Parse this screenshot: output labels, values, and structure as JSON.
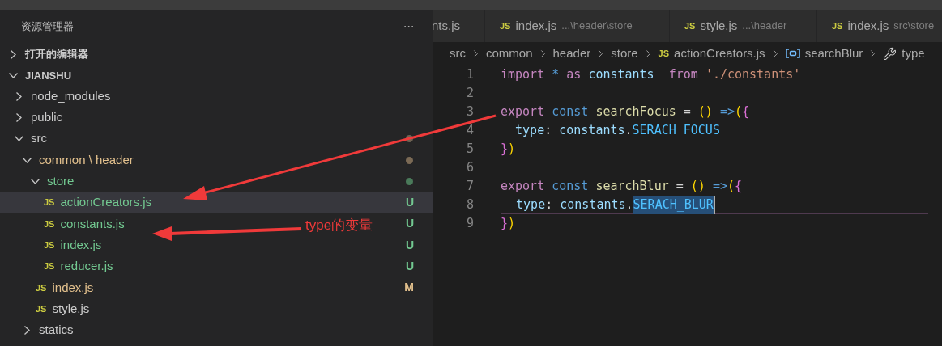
{
  "sidebar": {
    "title": "资源管理器",
    "more": "···",
    "sections": [
      {
        "label": "打开的编辑器",
        "expanded": false
      },
      {
        "label": "JIANSHU",
        "expanded": true
      }
    ],
    "tree": [
      {
        "label": "node_modules",
        "kind": "folder",
        "expanded": false,
        "modified": false,
        "untracked": false
      },
      {
        "label": "public",
        "kind": "folder",
        "expanded": false,
        "modified": false,
        "untracked": false
      },
      {
        "label": "src",
        "kind": "folder",
        "expanded": true,
        "modified": false,
        "untracked": false,
        "color": "#6e6353",
        "children": [
          {
            "label": "common \\ header",
            "kind": "folder",
            "expanded": true,
            "modified": true,
            "untracked": false,
            "color": "#7b6a55",
            "children": [
              {
                "label": "store",
                "kind": "folder",
                "expanded": true,
                "modified": false,
                "untracked": true,
                "color": "#4a7a5a",
                "children": [
                  {
                    "label": "actionCreators.js",
                    "kind": "js",
                    "icon": "JS",
                    "modified": false,
                    "untracked": true,
                    "badge": "U",
                    "selected": true
                  },
                  {
                    "label": "constants.js",
                    "kind": "js",
                    "icon": "JS",
                    "modified": false,
                    "untracked": true,
                    "badge": "U",
                    "selected": false
                  },
                  {
                    "label": "index.js",
                    "kind": "js",
                    "icon": "JS",
                    "modified": false,
                    "untracked": true,
                    "badge": "U",
                    "selected": false
                  },
                  {
                    "label": "reducer.js",
                    "kind": "js",
                    "icon": "JS",
                    "modified": false,
                    "untracked": true,
                    "badge": "U",
                    "selected": false
                  }
                ]
              },
              {
                "label": "index.js",
                "kind": "js",
                "icon": "JS",
                "modified": true,
                "untracked": false,
                "badge": "M",
                "selected": false
              },
              {
                "label": "style.js",
                "kind": "js",
                "icon": "JS",
                "modified": false,
                "untracked": false,
                "selected": false
              }
            ]
          },
          {
            "label": "statics",
            "kind": "folder",
            "expanded": false,
            "modified": false,
            "untracked": false
          }
        ]
      }
    ]
  },
  "tabs": [
    {
      "name": "nts.js"
    },
    {
      "icon": "JS",
      "name": "index.js",
      "path": "...\\header\\store"
    },
    {
      "icon": "JS",
      "name": "style.js",
      "path": "...\\header"
    },
    {
      "icon": "JS",
      "name": "index.js",
      "path": "src\\store"
    }
  ],
  "breadcrumb": [
    {
      "kind": "folder",
      "label": "src"
    },
    {
      "kind": "folder",
      "label": "common"
    },
    {
      "kind": "folder",
      "label": "header"
    },
    {
      "kind": "folder",
      "label": "store"
    },
    {
      "kind": "file",
      "icon": "JS",
      "label": "actionCreators.js"
    },
    {
      "kind": "variable",
      "label": "searchBlur"
    },
    {
      "kind": "property",
      "label": "type"
    }
  ],
  "code": [
    {
      "number": "1",
      "current": false,
      "tokens": [
        {
          "t": "import ",
          "kind": "keyword"
        },
        {
          "t": "* ",
          "kind": "storage"
        },
        {
          "t": "as ",
          "kind": "keyword"
        },
        {
          "t": "constants  ",
          "kind": "variable"
        },
        {
          "t": "from ",
          "kind": "keyword"
        },
        {
          "t": "'./constants'",
          "kind": "string"
        }
      ]
    },
    {
      "number": "2",
      "current": false
    },
    {
      "number": "3",
      "current": false,
      "tokens": [
        {
          "t": "export ",
          "kind": "keyword"
        },
        {
          "t": "const ",
          "kind": "storage"
        },
        {
          "t": "searchFocus ",
          "kind": "function"
        },
        {
          "t": "= ",
          "kind": "plain"
        },
        {
          "t": "() ",
          "kind": "bracket1"
        },
        {
          "t": "=>",
          "kind": "storage"
        },
        {
          "t": "(",
          "kind": "bracket1"
        },
        {
          "t": "{",
          "kind": "bracket2"
        }
      ]
    },
    {
      "number": "4",
      "current": false,
      "tokens": [
        {
          "t": "  type",
          "kind": "variable"
        },
        {
          "t": ": ",
          "kind": "plain"
        },
        {
          "t": "constants",
          "kind": "variable"
        },
        {
          "t": ".",
          "kind": "plain"
        },
        {
          "t": "SERACH_FOCUS",
          "kind": "constant"
        }
      ]
    },
    {
      "number": "5",
      "current": false,
      "tokens": [
        {
          "t": "}",
          "kind": "bracket2"
        },
        {
          "t": ")",
          "kind": "bracket1"
        }
      ]
    },
    {
      "number": "6",
      "current": false
    },
    {
      "number": "7",
      "current": false,
      "tokens": [
        {
          "t": "export ",
          "kind": "keyword"
        },
        {
          "t": "const ",
          "kind": "storage"
        },
        {
          "t": "searchBlur ",
          "kind": "function"
        },
        {
          "t": "= ",
          "kind": "plain"
        },
        {
          "t": "() ",
          "kind": "bracket1"
        },
        {
          "t": "=>",
          "kind": "storage"
        },
        {
          "t": "(",
          "kind": "bracket1"
        },
        {
          "t": "{",
          "kind": "bracket2"
        }
      ]
    },
    {
      "number": "8",
      "current": true,
      "tokens": [
        {
          "t": "  type",
          "kind": "variable"
        },
        {
          "t": ": ",
          "kind": "plain"
        },
        {
          "t": "constants",
          "kind": "variable"
        },
        {
          "t": ".",
          "kind": "plain"
        },
        {
          "t": "SERACH_BLUR",
          "kind": "constant",
          "selected": true
        }
      ]
    },
    {
      "number": "9",
      "current": false,
      "tokens": [
        {
          "t": "}",
          "kind": "bracket2"
        },
        {
          "t": ")",
          "kind": "bracket1"
        }
      ]
    }
  ],
  "annotation": {
    "text": "type的变量"
  }
}
